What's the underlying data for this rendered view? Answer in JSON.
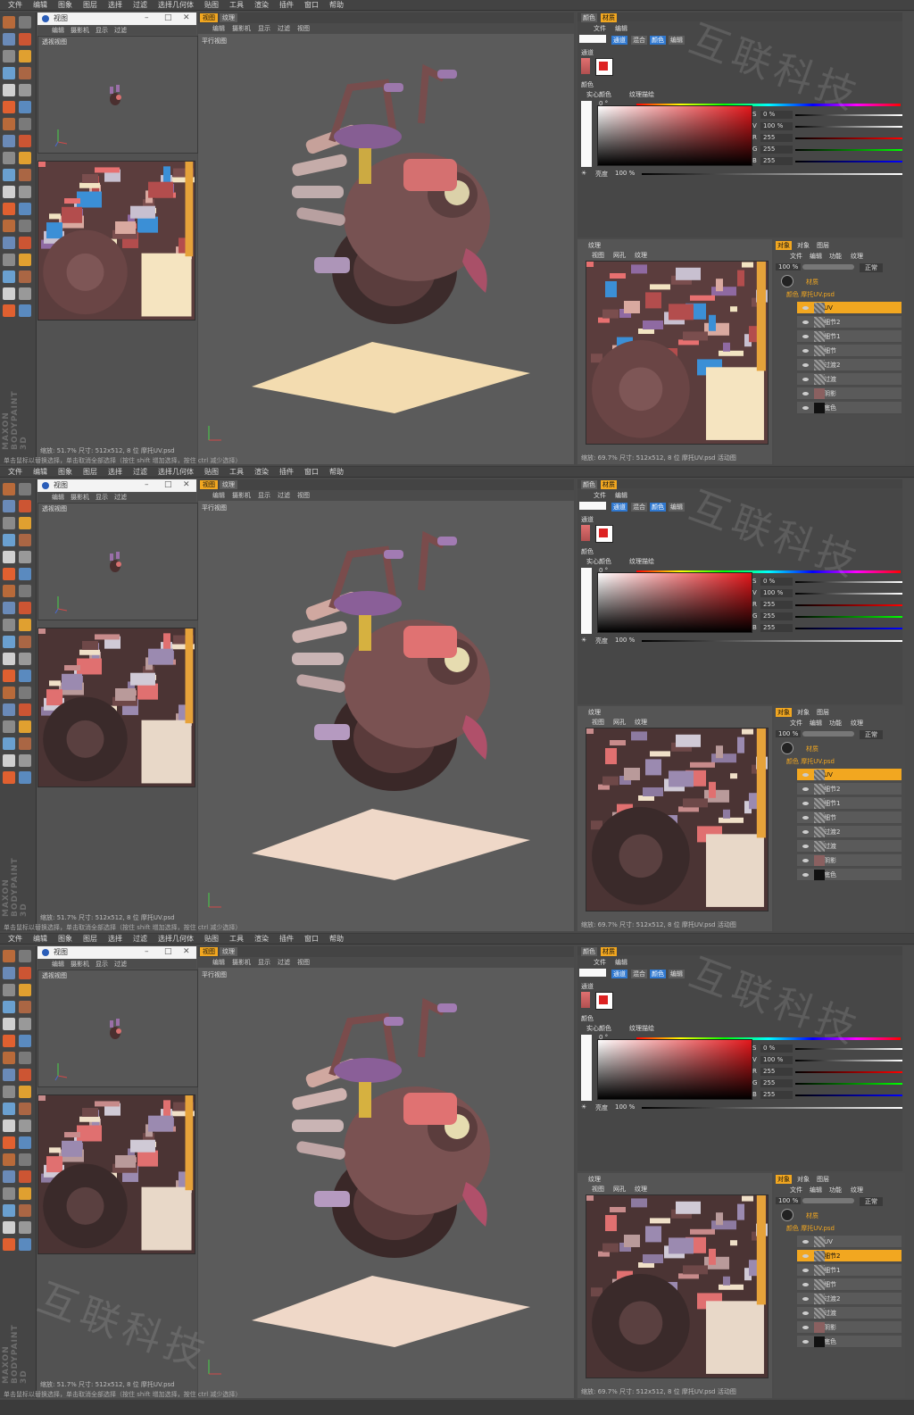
{
  "menu": [
    "文件",
    "编辑",
    "图象",
    "图层",
    "选择",
    "过滤",
    "选择几何体",
    "贴图",
    "工具",
    "渲染",
    "插件",
    "窗口",
    "帮助"
  ],
  "brand": "MAXON BODYPAINT 3D",
  "watermark": "互联科技",
  "status_hint": "单击鼠标以替换选择，单击取消全部选择（按住 shift 增加选择，按住 ctrl 减少选择）",
  "left_window": {
    "title": "视图",
    "menu": [
      "编辑",
      "摄影机",
      "显示",
      "过滤"
    ],
    "view_label": "透视视图",
    "status": "缩放: 51.7%  尺寸: 512x512, 8 位  摩托UV.psd"
  },
  "viewport": {
    "tabs": [
      "视图",
      "纹理"
    ],
    "menu": [
      "编辑",
      "摄影机",
      "显示",
      "过滤",
      "视图"
    ],
    "view_label": "平行视图"
  },
  "attributes": {
    "tabs": [
      "颜色",
      "材质"
    ],
    "menu": [
      "文件",
      "编辑"
    ],
    "channel_tabs": [
      "通道",
      "混合",
      "颜色",
      "编辑"
    ],
    "channel_label": "通道",
    "color_label": "颜色",
    "solid_color": "实心颜色",
    "texture_color": "纹理描绘",
    "hue_value": "0 °",
    "fields": [
      "0 %",
      "100 %",
      "255",
      "255",
      "255"
    ],
    "field_labels": [
      "S",
      "V",
      "R",
      "G",
      "B"
    ],
    "brightness_label": "亮度",
    "brightness_value": "100 %"
  },
  "texture_panel": {
    "title": "纹理",
    "menu": [
      "视图",
      "网孔",
      "纹理"
    ],
    "status": "缩放: 69.7%  尺寸: 512x512, 8 位  摩托UV.psd  活动图"
  },
  "layers": {
    "tabs": [
      "对象",
      "对象",
      "图层"
    ],
    "menu": [
      "文件",
      "编辑",
      "功能",
      "纹理"
    ],
    "zoom": "100 %",
    "mode": "正常",
    "material": "材质",
    "group": "颜色    摩托UV.psd",
    "items": [
      "UV",
      "细节2",
      "细节1",
      "细节",
      "过渡2",
      "过渡",
      "阴影",
      "底色"
    ]
  },
  "panels": [
    {
      "selected_layer_index": 0,
      "left_texture_variant": "flat"
    },
    {
      "selected_layer_index": 0,
      "left_texture_variant": "detail"
    },
    {
      "selected_layer_index": 1,
      "left_texture_variant": "detail"
    }
  ],
  "colors": {
    "accent": "#f2a720",
    "bg": "#4a4a4a",
    "viewport": "#5b5b5b"
  }
}
